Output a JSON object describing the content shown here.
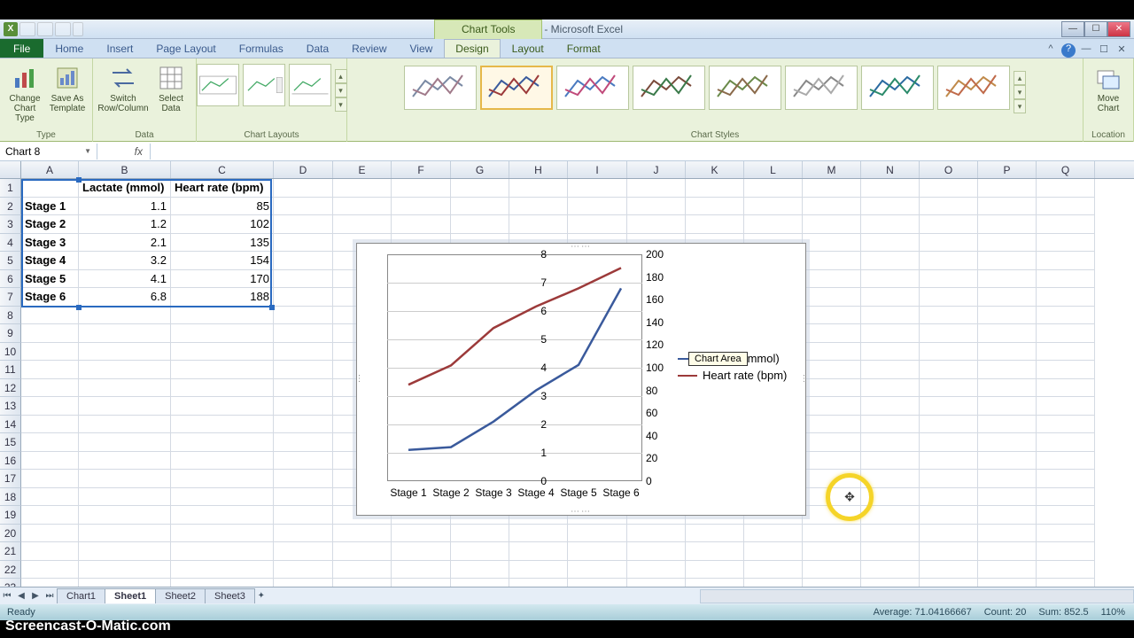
{
  "title": "Book1 - Microsoft Excel",
  "chart_tools_label": "Chart Tools",
  "tabs": {
    "file": "File",
    "home": "Home",
    "insert": "Insert",
    "page_layout": "Page Layout",
    "formulas": "Formulas",
    "data": "Data",
    "review": "Review",
    "view": "View",
    "design": "Design",
    "layout": "Layout",
    "format": "Format"
  },
  "ribbon": {
    "type_group": "Type",
    "change_chart_type": "Change Chart Type",
    "save_as_template": "Save As Template",
    "data_group": "Data",
    "switch_rowcol": "Switch Row/Column",
    "select_data": "Select Data",
    "chart_layouts": "Chart Layouts",
    "chart_styles": "Chart Styles",
    "location_group": "Location",
    "move_chart": "Move Chart"
  },
  "name_box": "Chart 8",
  "columns": [
    "A",
    "B",
    "C",
    "D",
    "E",
    "F",
    "G",
    "H",
    "I",
    "J",
    "K",
    "L",
    "M",
    "N",
    "O",
    "P",
    "Q"
  ],
  "col_classes": [
    "cA",
    "cB",
    "cC",
    "cD",
    "cE",
    "cF",
    "cG",
    "cH",
    "cI",
    "cJ",
    "cK",
    "cL",
    "cM",
    "cN",
    "cO",
    "cP",
    "cQ"
  ],
  "headers": {
    "b1": "Lactate (mmol)",
    "c1": "Heart rate (bpm)"
  },
  "rows": [
    {
      "a": "Stage 1",
      "b": "1.1",
      "c": "85"
    },
    {
      "a": "Stage 2",
      "b": "1.2",
      "c": "102"
    },
    {
      "a": "Stage 3",
      "b": "2.1",
      "c": "135"
    },
    {
      "a": "Stage 4",
      "b": "3.2",
      "c": "154"
    },
    {
      "a": "Stage 5",
      "b": "4.1",
      "c": "170"
    },
    {
      "a": "Stage 6",
      "b": "6.8",
      "c": "188"
    }
  ],
  "chart_data": {
    "type": "line",
    "categories": [
      "Stage 1",
      "Stage 2",
      "Stage 3",
      "Stage 4",
      "Stage 5",
      "Stage 6"
    ],
    "series": [
      {
        "name": "Lactate (mmol)",
        "axis": "primary",
        "values": [
          1.1,
          1.2,
          2.1,
          3.2,
          4.1,
          6.8
        ],
        "color": "#3a5a9c"
      },
      {
        "name": "Heart rate (bpm)",
        "axis": "secondary",
        "values": [
          85,
          102,
          135,
          154,
          170,
          188
        ],
        "color": "#9c3a3a"
      }
    ],
    "y1": {
      "min": 0,
      "max": 8,
      "ticks": [
        0,
        1,
        2,
        3,
        4,
        5,
        6,
        7,
        8
      ]
    },
    "y2": {
      "min": 0,
      "max": 200,
      "ticks": [
        0,
        20,
        40,
        60,
        80,
        100,
        120,
        140,
        160,
        180,
        200
      ]
    },
    "tooltip": "Chart Area"
  },
  "sheet_tabs": [
    "Chart1",
    "Sheet1",
    "Sheet2",
    "Sheet3"
  ],
  "active_sheet": "Sheet1",
  "status": {
    "ready": "Ready",
    "average": "Average: 71.04166667",
    "count": "Count: 20",
    "sum": "Sum: 852.5",
    "zoom": "110%"
  },
  "watermark": "Screencast-O-Matic.com"
}
